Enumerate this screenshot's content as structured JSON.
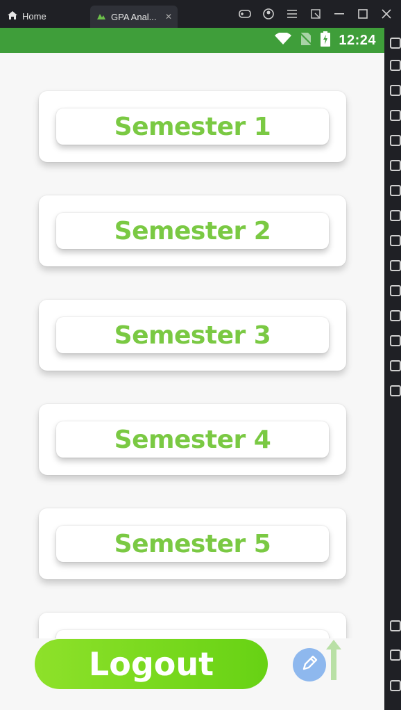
{
  "window": {
    "tabs": [
      {
        "label": "Home"
      },
      {
        "label": "GPA Anal..."
      }
    ]
  },
  "statusbar": {
    "time": "12:24"
  },
  "semesters": [
    {
      "label": "Semester 1"
    },
    {
      "label": "Semester 2"
    },
    {
      "label": "Semester 3"
    },
    {
      "label": "Semester 4"
    },
    {
      "label": "Semester 5"
    },
    {
      "label": ""
    }
  ],
  "actions": {
    "logout_label": "Logout"
  },
  "colors": {
    "accent_green": "#7ac943",
    "status_bar": "#3f9e3a",
    "logout_start": "#8ee12a",
    "edit_fab": "#8eb8ee"
  },
  "icons": [
    "home-icon",
    "app-icon",
    "close-icon",
    "gamepad-icon",
    "account-icon",
    "menu-icon",
    "expand-icon",
    "minimize-icon",
    "maximize-icon",
    "window-close-icon",
    "wifi-icon",
    "no-signal-icon",
    "battery-icon",
    "edit-icon",
    "arrow-up-icon"
  ]
}
